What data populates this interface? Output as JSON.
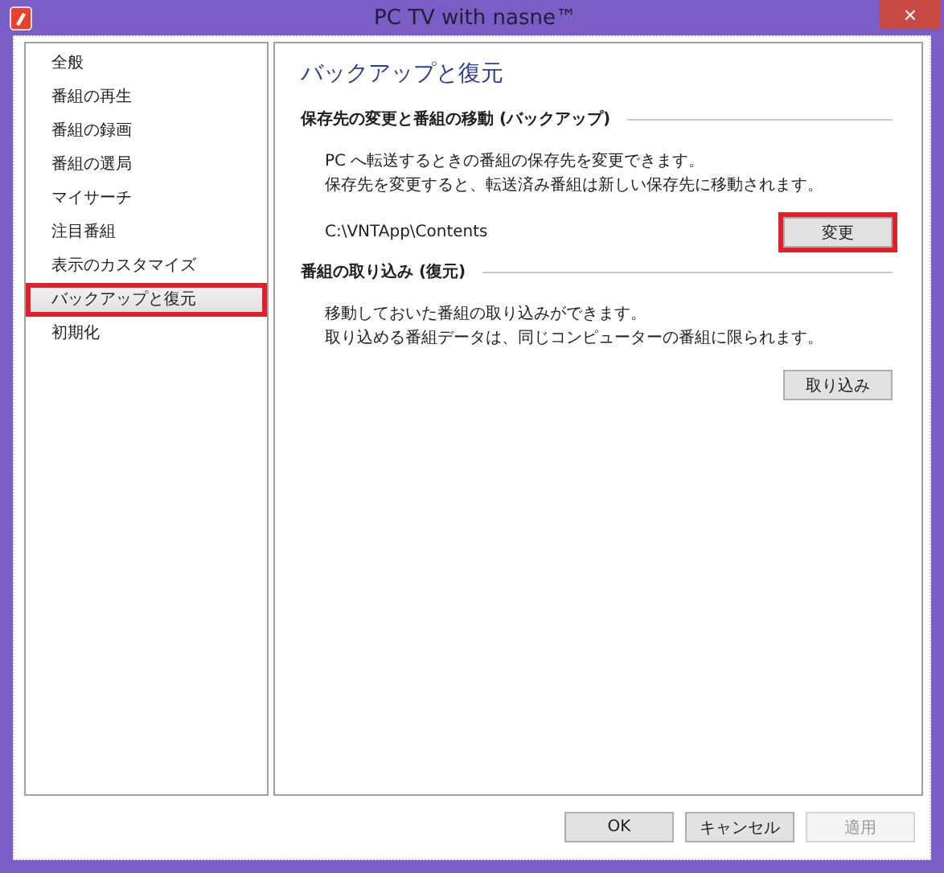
{
  "window": {
    "title": "PC TV with nasne™",
    "close_label": "×"
  },
  "sidebar": {
    "items": [
      {
        "label": "全般",
        "selected": false,
        "highlighted": false
      },
      {
        "label": "番組の再生",
        "selected": false,
        "highlighted": false
      },
      {
        "label": "番組の録画",
        "selected": false,
        "highlighted": false
      },
      {
        "label": "番組の選局",
        "selected": false,
        "highlighted": false
      },
      {
        "label": "マイサーチ",
        "selected": false,
        "highlighted": false
      },
      {
        "label": "注目番組",
        "selected": false,
        "highlighted": false
      },
      {
        "label": "表示のカスタマイズ",
        "selected": false,
        "highlighted": false
      },
      {
        "label": "バックアップと復元",
        "selected": true,
        "highlighted": true
      },
      {
        "label": "初期化",
        "selected": false,
        "highlighted": false
      }
    ]
  },
  "panel": {
    "title": "バックアップと復元",
    "sections": [
      {
        "heading": "保存先の変更と番組の移動 (バックアップ)",
        "lines": [
          "PC へ転送するときの番組の保存先を変更できます。",
          "保存先を変更すると、転送済み番組は新しい保存先に移動されます。"
        ],
        "path": "C:\\VNTApp\\Contents",
        "button": {
          "label": "変更",
          "highlighted": true
        }
      },
      {
        "heading": "番組の取り込み (復元)",
        "lines": [
          "移動しておいた番組の取り込みができます。",
          "取り込める番組データは、同じコンピューターの番組に限られます。"
        ],
        "button": {
          "label": "取り込み",
          "highlighted": false
        }
      }
    ]
  },
  "buttons": [
    {
      "label": "OK",
      "disabled": false
    },
    {
      "label": "キャンセル",
      "disabled": false
    },
    {
      "label": "適用",
      "disabled": true
    }
  ]
}
